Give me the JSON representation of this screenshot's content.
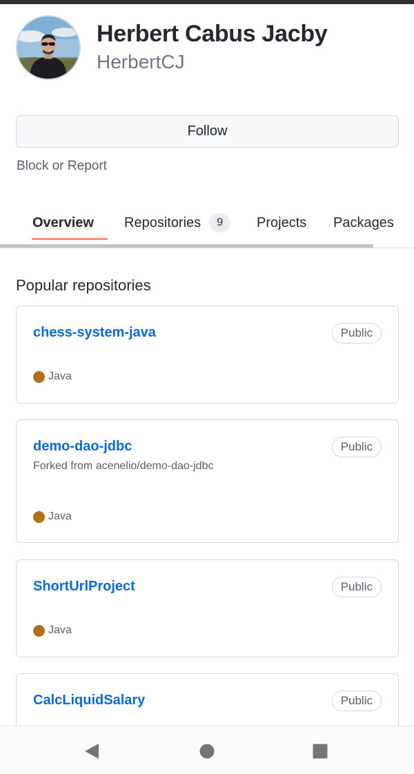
{
  "profile": {
    "full_name": "Herbert Cabus Jacby",
    "username": "HerbertCJ"
  },
  "actions": {
    "follow_label": "Follow",
    "block_report_label": "Block or Report"
  },
  "tabs": [
    {
      "label": "Overview",
      "selected": true
    },
    {
      "label": "Repositories",
      "count": "9"
    },
    {
      "label": "Projects"
    },
    {
      "label": "Packages"
    }
  ],
  "popular": {
    "title": "Popular repositories",
    "repos": [
      {
        "name": "chess-system-java",
        "visibility": "Public",
        "language": "Java"
      },
      {
        "name": "demo-dao-jdbc",
        "visibility": "Public",
        "fork_note": "Forked from acenelio/demo-dao-jdbc",
        "language": "Java"
      },
      {
        "name": "ShortUrlProject",
        "visibility": "Public",
        "language": "Java"
      },
      {
        "name": "CalcLiquidSalary",
        "visibility": "Public"
      }
    ]
  },
  "colors": {
    "link_blue": "#0969da",
    "tab_underline": "#fd8c73",
    "java_language": "#b07219"
  },
  "icons": {
    "nav_back": "triangle-back-icon",
    "nav_home": "circle-home-icon",
    "nav_recents": "square-recents-icon"
  }
}
